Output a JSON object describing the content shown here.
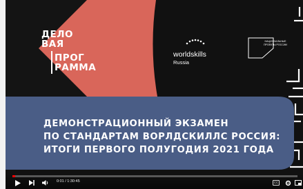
{
  "slide": {
    "logo_lines": [
      "ДЕЛО",
      "ВАЯ",
      "ПРОГ",
      "РАММА"
    ],
    "worldskills": {
      "name": "worldskills",
      "sub": "Russia"
    },
    "national_projects": "НАЦИОНАЛЬНЫЕ ПРОЕКТЫ РОССИИ",
    "title_lines": [
      "ДЕМОНСТРАЦИОННЫЙ ЭКЗАМЕН",
      "ПО СТАНДАРТАМ ВОРЛДСКИЛЛС РОССИЯ:",
      "ИТОГИ ПЕРВОГО ПОЛУГОДИЯ 2021 ГОДА"
    ]
  },
  "player": {
    "time_display": "0:01 / 1:30:45",
    "cc_label": "CC",
    "progress_fraction": 0.002,
    "icons": [
      "play-icon",
      "next-icon",
      "volume-icon",
      "subtitles-icon",
      "settings-icon",
      "miniplayer-icon"
    ]
  },
  "colors": {
    "coral": "#d9665a",
    "navy": "#111111",
    "slate_blue": "#4a5d86",
    "progress": "#ff0000"
  }
}
